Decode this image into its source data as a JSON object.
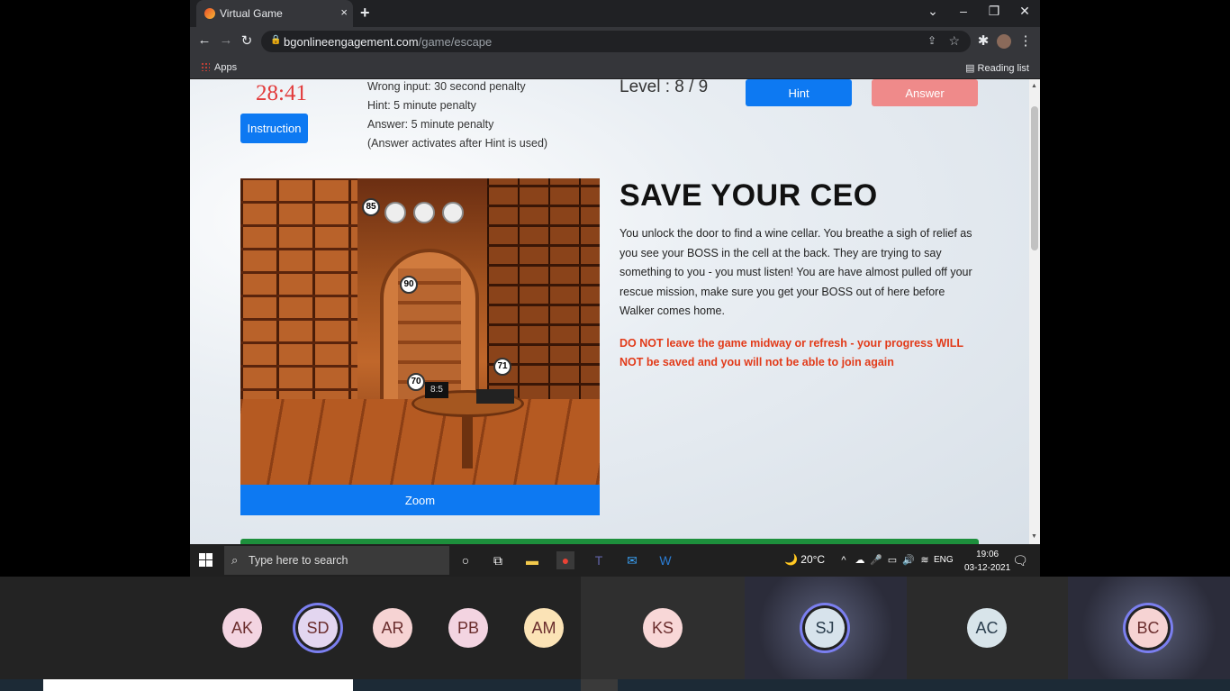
{
  "browser": {
    "tab_title": "Virtual Game",
    "tab_close": "×",
    "new_tab": "+",
    "url_host": "bgonlineengagement.com",
    "url_path": "/game/escape",
    "apps_label": "Apps",
    "reading_list": "Reading list",
    "window_controls": [
      "⌄",
      "–",
      "❐",
      "✕"
    ]
  },
  "game": {
    "timer": "28:41",
    "instruction_label": "Instruction",
    "penalties": [
      "Wrong input: 30 second penalty",
      "Hint: 5 minute penalty",
      "Answer: 5 minute penalty",
      "(Answer activates after Hint is used)"
    ],
    "level": "Level : 8 / 9",
    "hint_label": "Hint",
    "answer_label": "Answer",
    "scene_markers": [
      "85",
      "90",
      "70",
      "71"
    ],
    "digital_display": "8:5",
    "zoom_label": "Zoom",
    "story_title": "SAVE YOUR CEO",
    "story_text": "You unlock the door to find a wine cellar. You breathe a sigh of relief as you see your BOSS in the cell at the back. They are trying to say something to you - you must listen! You are have almost pulled off your rescue mission, make sure you get your BOSS out of here before Walker comes home.",
    "story_warning": "DO NOT leave the game midway or refresh - your progress WILL NOT be saved and you will not be able to join again"
  },
  "taskbar": {
    "search_placeholder": "Type here to search",
    "weather": "20°C",
    "language": "ENG",
    "time": "19:06",
    "date": "03-12-2021"
  },
  "meeting": {
    "participants": [
      {
        "initials": "AK",
        "bg": "#f3d4e1"
      },
      {
        "initials": "SD",
        "bg": "#e3d6f0"
      },
      {
        "initials": "AR",
        "bg": "#f6d3d3"
      },
      {
        "initials": "PB",
        "bg": "#f3d4e1"
      },
      {
        "initials": "AM",
        "bg": "#fbe3b6"
      },
      {
        "initials": "KS",
        "bg": "#f8d7d7"
      },
      {
        "initials": "SJ",
        "bg": "#d7e3ec"
      },
      {
        "initials": "AC",
        "bg": "#d8e4ea"
      },
      {
        "initials": "BC",
        "bg": "#f6d3d3"
      }
    ]
  },
  "colors": {
    "primary_button": "#0d79f2",
    "answer_button": "#ef8a8a",
    "timer": "#e23b3b",
    "warning": "#e23b1a",
    "active_ring": "#7b7ff0"
  }
}
